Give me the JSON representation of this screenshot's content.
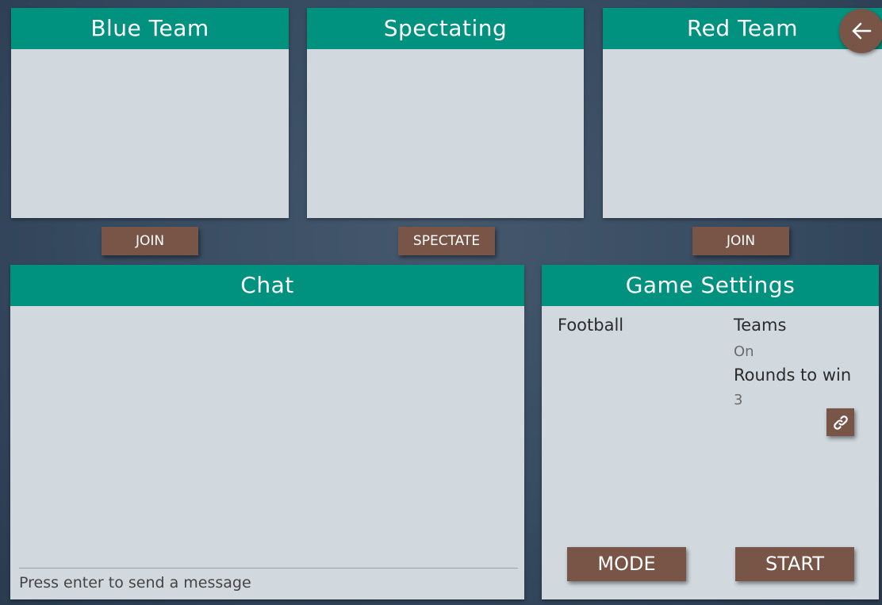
{
  "teams": {
    "blue": {
      "title": "Blue Team",
      "join_label": "JOIN",
      "players": []
    },
    "spectating": {
      "title": "Spectating",
      "spectate_label": "SPECTATE",
      "players": []
    },
    "red": {
      "title": "Red Team",
      "join_label": "JOIN",
      "players": []
    }
  },
  "chat": {
    "title": "Chat",
    "messages": [],
    "input_placeholder": "Press enter to send a message"
  },
  "game_settings": {
    "title": "Game Settings",
    "mode_name": "Football",
    "settings": [
      {
        "label": "Teams",
        "value": "On"
      },
      {
        "label": "Rounds to win",
        "value": "3"
      }
    ],
    "mode_button": "MODE",
    "start_button": "START"
  },
  "icons": {
    "back": "arrow-left-icon",
    "link": "link-icon"
  },
  "colors": {
    "header": "#00927f",
    "panel": "#d1d9df",
    "button": "#795548",
    "background": "#364a60"
  }
}
